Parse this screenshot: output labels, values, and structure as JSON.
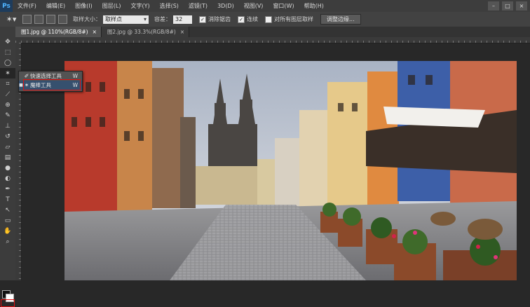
{
  "app": {
    "logo": "Ps"
  },
  "menu": [
    "文件(F)",
    "编辑(E)",
    "图像(I)",
    "图层(L)",
    "文字(Y)",
    "选择(S)",
    "滤镜(T)",
    "3D(D)",
    "视图(V)",
    "窗口(W)",
    "帮助(H)"
  ],
  "window_controls": [
    "–",
    "□",
    "×"
  ],
  "options": {
    "sample_size_label": "取样大小：",
    "sample_size_value": "取样点",
    "tolerance_label": "容差：",
    "tolerance_value": "32",
    "antialias_label": "消除锯齿",
    "contiguous_label": "连续",
    "sample_all_label": "对所有图层取样",
    "refine_edge_label": "调整边缘..."
  },
  "tabs": [
    {
      "label": "图1.jpg @ 110%(RGB/8#)",
      "close": "×"
    },
    {
      "label": "图2.jpg @ 33.3%(RGB/8#)",
      "close": "×"
    }
  ],
  "flyout": {
    "items": [
      {
        "label": "快速选择工具",
        "key": "W"
      },
      {
        "label": "魔棒工具",
        "key": "W"
      }
    ]
  },
  "colors": {
    "accent_red": "#e01010",
    "selected_blue": "#36506e"
  }
}
